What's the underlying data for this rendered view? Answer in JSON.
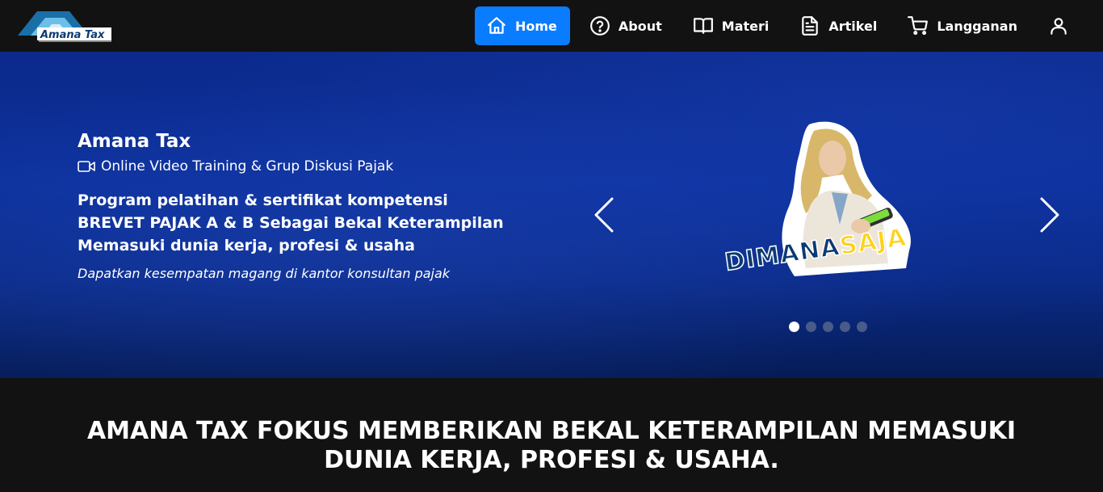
{
  "header": {
    "logo_text": "Amana Tax",
    "nav": [
      {
        "label": "Home",
        "icon": "home-icon",
        "active": true
      },
      {
        "label": "About",
        "icon": "help-circle-icon"
      },
      {
        "label": "Materi",
        "icon": "book-icon"
      },
      {
        "label": "Artikel",
        "icon": "document-icon"
      },
      {
        "label": "Langganan",
        "icon": "cart-icon"
      },
      {
        "label": "",
        "icon": "user-icon"
      }
    ]
  },
  "hero": {
    "brand": "Amana Tax",
    "subtitle": "Online Video Training & Grup Diskusi Pajak",
    "description_lines": [
      "Program pelatihan & sertifikat kompetensi",
      "BREVET PAJAK A & B Sebagai Bekal Keterampilan",
      "Memasuki dunia kerja, profesi & usaha"
    ],
    "note": "Dapatkan kesempatan magang di kantor konsultan pajak",
    "slide": {
      "word1": "DIMANA",
      "word2": "SAJA"
    },
    "slide_count": 5,
    "active_slide": 1
  },
  "section": {
    "headline_lines": [
      "AMANA TAX FOKUS MEMBERIKAN BEKAL KETERAMPILAN MEMASUKI",
      "DUNIA KERJA, PROFESI & USAHA."
    ]
  },
  "colors": {
    "nav_background": "#121212",
    "nav_active": "#0a7cff",
    "hero_blue": "#0b2f9a",
    "sticker_blue": "#0b3a74",
    "sticker_yellow": "#ffd21a"
  }
}
